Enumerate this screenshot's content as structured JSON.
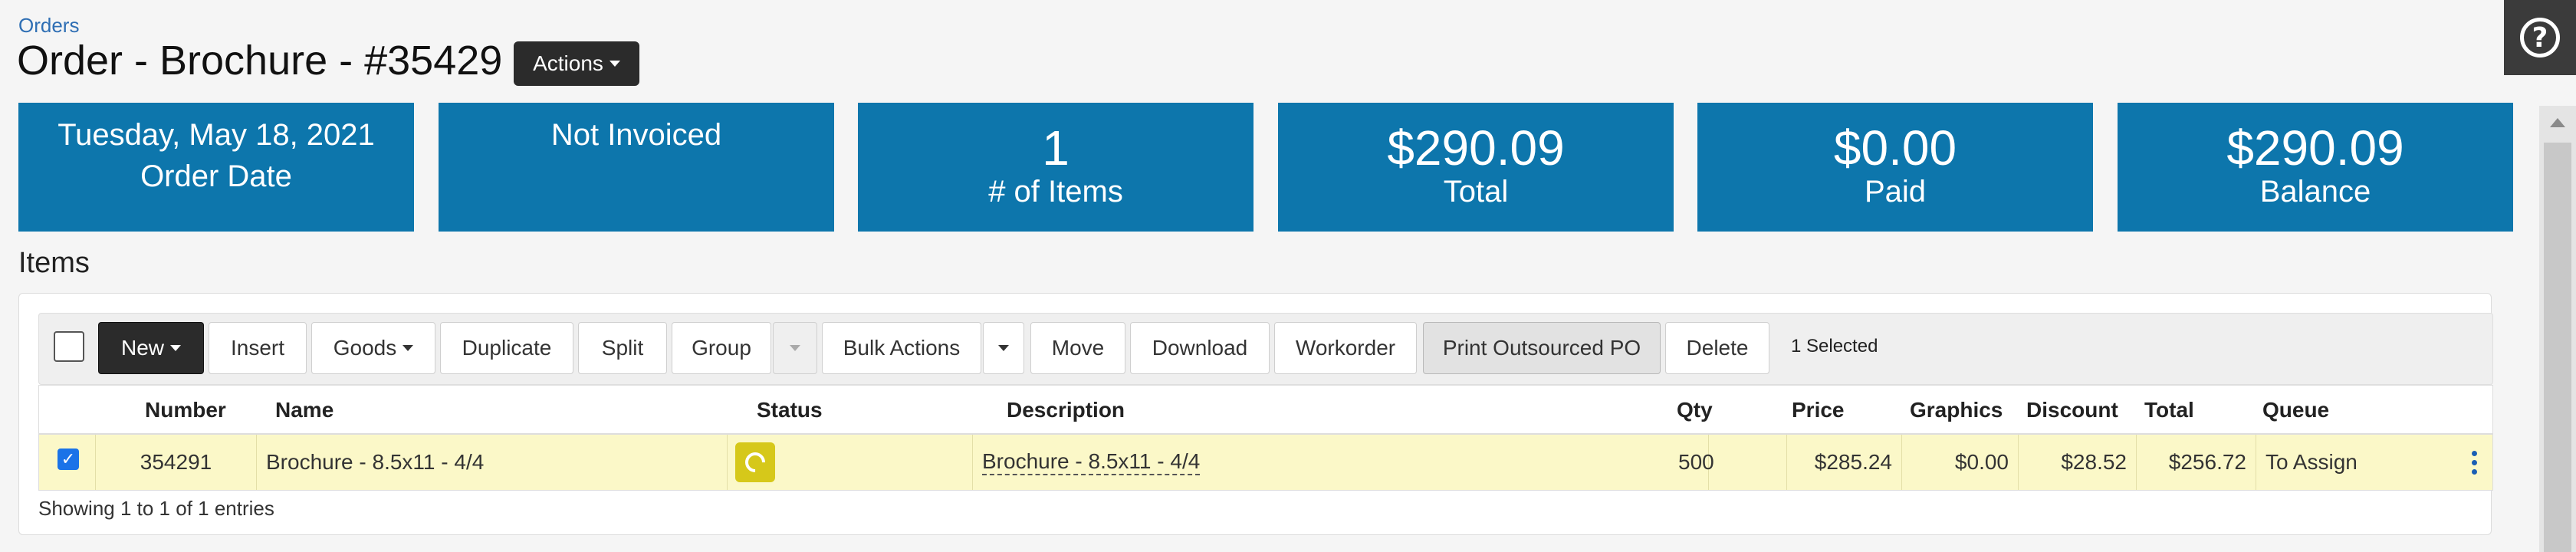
{
  "breadcrumb": "Orders",
  "page_title": "Order - Brochure - #35429",
  "actions_label": "Actions",
  "help_icon": "question-circle-icon",
  "cards": {
    "order_date": {
      "line1": "Tuesday, May 18, 2021",
      "line2": "Order Date"
    },
    "invoice": {
      "line1": "Not Invoiced"
    },
    "items": {
      "value": "1",
      "label": "# of Items"
    },
    "total": {
      "value": "$290.09",
      "label": "Total"
    },
    "paid": {
      "value": "$0.00",
      "label": "Paid"
    },
    "balance": {
      "value": "$290.09",
      "label": "Balance"
    }
  },
  "items_section_title": "Items",
  "toolbar": {
    "new": "New",
    "insert": "Insert",
    "goods": "Goods",
    "duplicate": "Duplicate",
    "split": "Split",
    "group": "Group",
    "bulk_actions": "Bulk Actions",
    "move": "Move",
    "download": "Download",
    "workorder": "Workorder",
    "print_outsourced_po": "Print Outsourced PO",
    "delete": "Delete",
    "selected": "1 Selected"
  },
  "table": {
    "headers": {
      "number": "Number",
      "name": "Name",
      "status": "Status",
      "description": "Description",
      "qty": "Qty",
      "price": "Price",
      "graphics": "Graphics",
      "discount": "Discount",
      "total": "Total",
      "queue": "Queue"
    },
    "rows": [
      {
        "checked": true,
        "number": "354291",
        "name": "Brochure - 8.5x11 - 4/4",
        "status_icon": "status-pending-icon",
        "description": "Brochure - 8.5x11 - 4/4",
        "qty": "500",
        "price": "$285.24",
        "graphics": "$0.00",
        "discount": "$28.52",
        "total": "$256.72",
        "queue": "To Assign"
      }
    ]
  },
  "showing": "Showing 1 to 1 of 1 entries",
  "colors": {
    "card_blue": "#0d76ac",
    "selected_row": "#fbf8c8",
    "status_yellow": "#d6c81a"
  }
}
